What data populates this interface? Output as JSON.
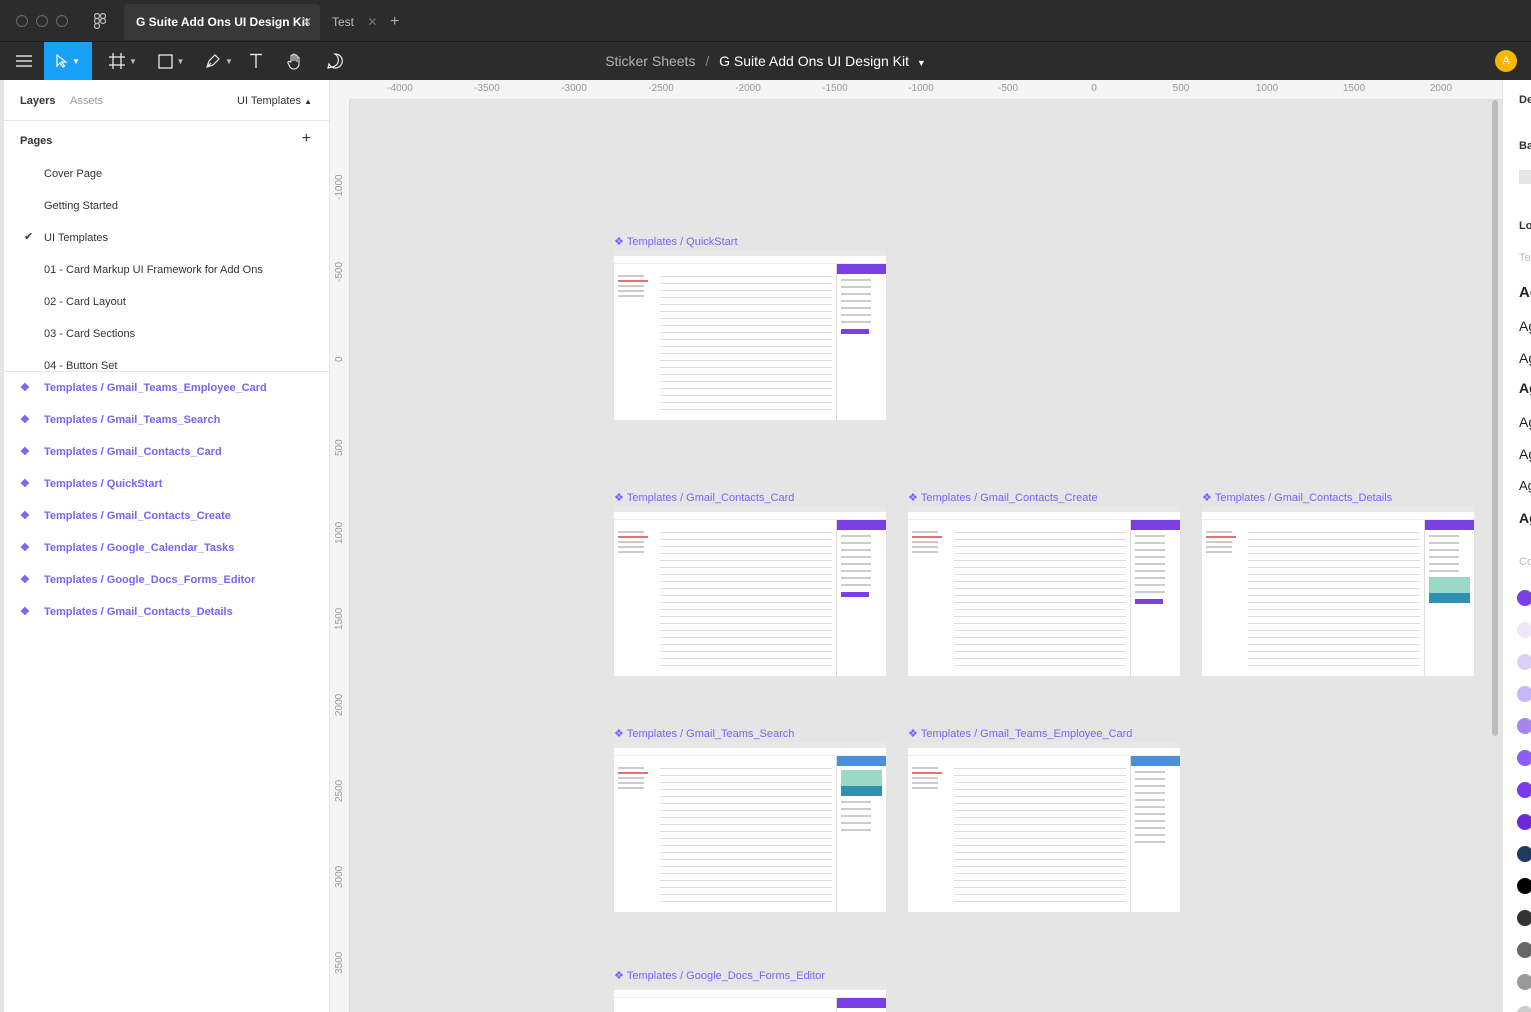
{
  "tabs": [
    {
      "label": "G Suite Add Ons UI Design Kit",
      "active": true
    },
    {
      "label": "Test",
      "active": false
    }
  ],
  "toolbar": {
    "breadcrumb_parent": "Sticker Sheets",
    "breadcrumb_sep": "/",
    "breadcrumb_file": "G Suite Add Ons UI Design Kit",
    "avatar_initial": "A"
  },
  "left_panel": {
    "tab_layers": "Layers",
    "tab_assets": "Assets",
    "current_page": "UI Templates",
    "pages_title": "Pages",
    "pages": [
      "Cover Page",
      "Getting Started",
      "UI Templates",
      "01 - Card Markup UI Framework for Add Ons",
      "02 - Card Layout",
      "03 - Card Sections",
      "04 - Button Set"
    ],
    "layers": [
      "Templates / Gmail_Teams_Employee_Card",
      "Templates / Gmail_Teams_Search",
      "Templates / Gmail_Contacts_Card",
      "Templates / QuickStart",
      "Templates / Gmail_Contacts_Create",
      "Templates / Google_Calendar_Tasks",
      "Templates / Google_Docs_Forms_Editor",
      "Templates / Gmail_Contacts_Details"
    ]
  },
  "canvas": {
    "ruler_x": [
      "-4000",
      "-3500",
      "-3000",
      "-2500",
      "-2000",
      "-1500",
      "-1000",
      "-500",
      "0",
      "500",
      "1000",
      "1500",
      "2000"
    ],
    "ruler_y": [
      "-1000",
      "-500",
      "0",
      "500",
      "1000",
      "1500",
      "2000",
      "2500",
      "3000",
      "3500"
    ],
    "frames": [
      {
        "label": "Templates / QuickStart"
      },
      {
        "label": "Templates / Gmail_Contacts_Card"
      },
      {
        "label": "Templates / Gmail_Contacts_Create"
      },
      {
        "label": "Templates / Gmail_Contacts_Details"
      },
      {
        "label": "Templates / Gmail_Teams_Search"
      },
      {
        "label": "Templates / Gmail_Teams_Employee_Card"
      },
      {
        "label": "Templates / Google_Docs_Forms_Editor"
      }
    ]
  },
  "right_panel": {
    "header_fragment": "De",
    "bg_fragment": "Ba",
    "local_fragment": "Lo",
    "te_fragment": "Te",
    "ag_sample": "Ag",
    "co_fragment": "Co",
    "swatch_colors": [
      "#7b3fe4",
      "#ede7fb",
      "#dcd0f9",
      "#c9b6f6",
      "#a685ef",
      "#8b5cf6",
      "#7c3aed",
      "#6d28d9",
      "#1e3a5f",
      "#000000",
      "#333333",
      "#666666",
      "#999999",
      "#cccccc"
    ]
  },
  "colors": {
    "accent": "#18a0fb",
    "component": "#7b61ff",
    "toolbar_bg": "#2c2c2c",
    "avatar": "#f5b700"
  }
}
